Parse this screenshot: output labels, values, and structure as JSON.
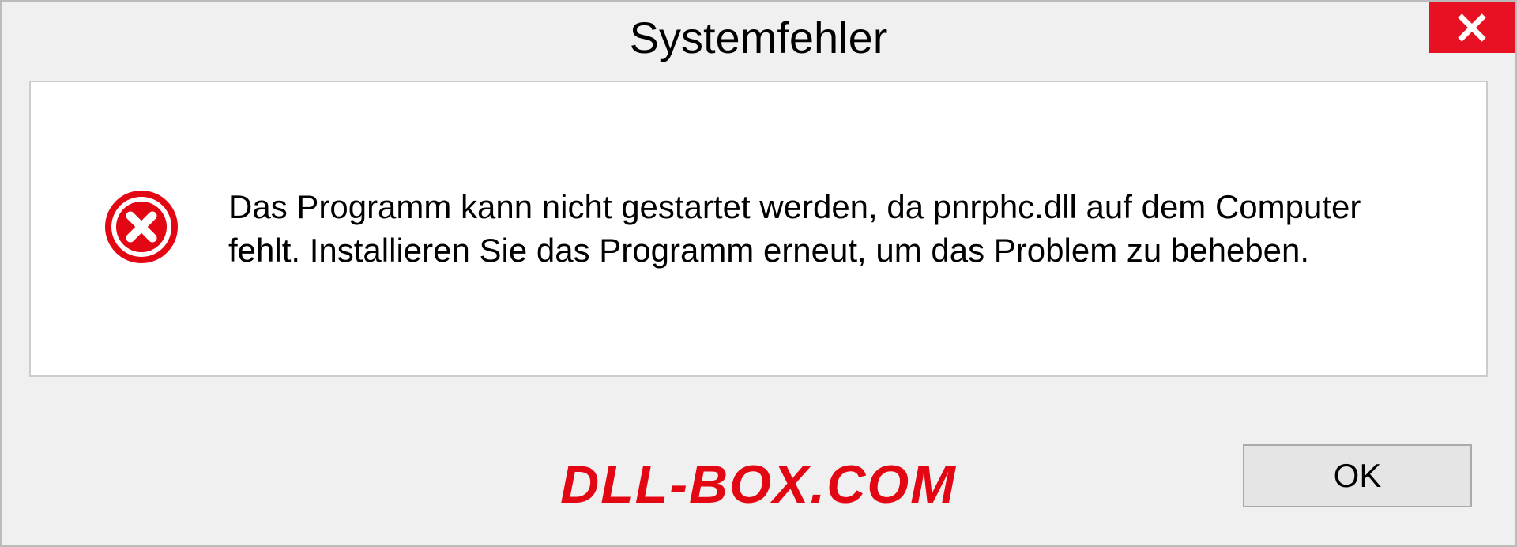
{
  "dialog": {
    "title": "Systemfehler",
    "message": "Das Programm kann nicht gestartet werden, da pnrphc.dll auf dem Computer fehlt. Installieren Sie das Programm erneut, um das Problem zu beheben.",
    "ok_label": "OK"
  },
  "watermark": "DLL-BOX.COM",
  "colors": {
    "close_bg": "#e81123",
    "error_icon": "#e30613",
    "watermark": "#e30613"
  }
}
